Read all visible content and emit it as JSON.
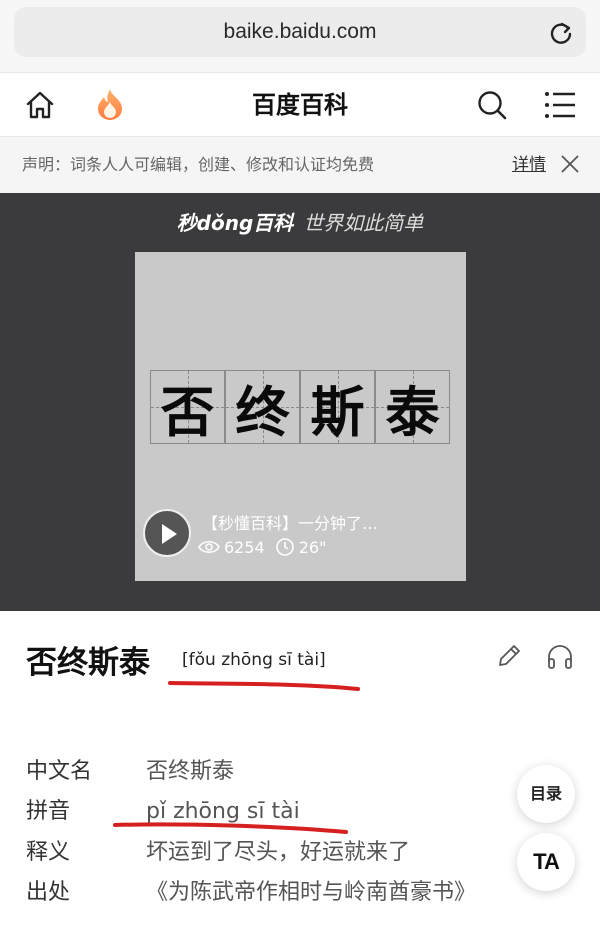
{
  "browser": {
    "url": "baike.baidu.com",
    "reload_icon": "reload-icon"
  },
  "nav": {
    "title": "百度百科",
    "icons": [
      "home-icon",
      "fire-icon",
      "search-icon",
      "menu-icon"
    ]
  },
  "notice": {
    "text": "声明：词条人人可编辑，创建、修改和认证均免费",
    "link": "详情",
    "close_icon": "close-icon"
  },
  "video": {
    "brand": "秒dǒng百科",
    "slogan": "世界如此简单",
    "characters": [
      "否",
      "终",
      "斯",
      "泰"
    ],
    "title": "【秒懂百科】一分钟了…",
    "views": "6254",
    "duration": "26\""
  },
  "entry": {
    "title": "否终斯泰",
    "pinyin": "[fǒu zhōng sī tài]",
    "icons": [
      "edit-icon",
      "headphones-icon"
    ],
    "annotation_color": "#d62020"
  },
  "info": [
    {
      "label": "中文名",
      "value": "否终斯泰"
    },
    {
      "label": "拼音",
      "value": "pǐ zhōng sī tài"
    },
    {
      "label": "释义",
      "value": "坏运到了尽头，好运就来了"
    },
    {
      "label": "出处",
      "value": "《为陈武帝作相时与岭南酋豪书》"
    }
  ],
  "floating": {
    "toc": "目录",
    "ta": "TA"
  }
}
